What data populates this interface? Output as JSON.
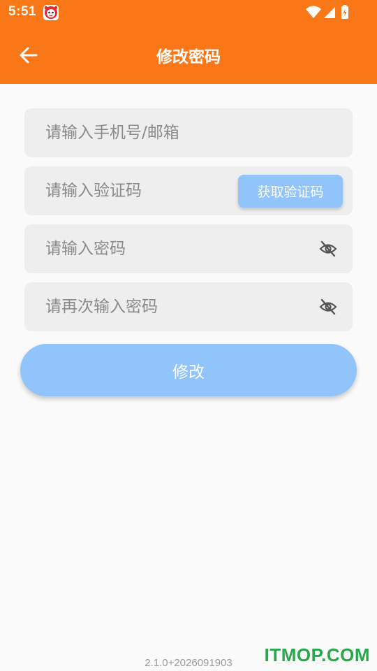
{
  "status_bar": {
    "time": "5:51",
    "app_icon": "red-mascot-icon",
    "icons": [
      "wifi-icon",
      "signal-icon",
      "battery-charging-icon"
    ]
  },
  "app_bar": {
    "title": "修改密码",
    "back_icon": "arrow-left-icon"
  },
  "form": {
    "phone_placeholder": "请输入手机号/邮箱",
    "phone_value": "",
    "code_placeholder": "请输入验证码",
    "code_value": "",
    "get_code_label": "获取验证码",
    "password_placeholder": "请输入密码",
    "password_value": "",
    "confirm_placeholder": "请再次输入密码",
    "confirm_value": "",
    "visibility_icon": "eye-off-icon",
    "submit_label": "修改"
  },
  "footer": {
    "version": "2.1.0+2026091903",
    "watermark": "ITMOP.COM"
  },
  "colors": {
    "primary": "#fa7718",
    "button": "#90c4fa",
    "field_background": "#eeeeee",
    "page_background": "#fafafa",
    "watermark": "#29a84a"
  }
}
